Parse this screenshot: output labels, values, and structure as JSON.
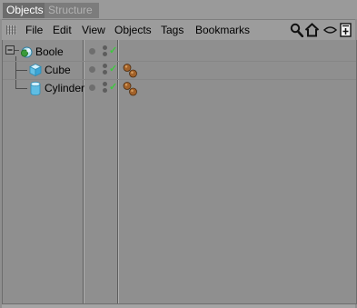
{
  "tabs": [
    {
      "label": "Objects",
      "active": true
    },
    {
      "label": "Structure",
      "active": false
    }
  ],
  "menu": {
    "items": [
      "File",
      "Edit",
      "View",
      "Objects",
      "Tags",
      "Bookmarks"
    ]
  },
  "toolbar_icons": [
    "search-icon",
    "home-icon",
    "eye-icon",
    "new-panel-icon"
  ],
  "objects": [
    {
      "name": "Boole",
      "icon": "boole-icon",
      "level": 0,
      "expanded": true,
      "enabled": true,
      "has_tag": false
    },
    {
      "name": "Cube",
      "icon": "cube-icon",
      "level": 1,
      "enabled": true,
      "has_tag": true
    },
    {
      "name": "Cylinder",
      "icon": "cylinder-icon",
      "level": 1,
      "enabled": true,
      "has_tag": true
    }
  ],
  "colors": {
    "background": "#8f8f8f",
    "active_tab": "#6c6c6c",
    "check": "#3ec93e",
    "tag": "#9b5a21"
  }
}
